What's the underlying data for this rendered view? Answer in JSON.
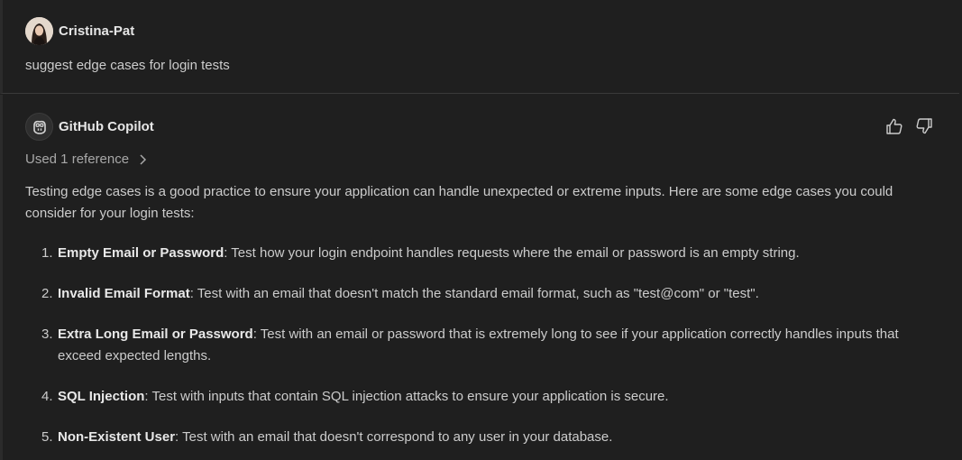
{
  "user": {
    "name": "Cristina-Pat",
    "message": "suggest edge cases for login tests"
  },
  "copilot": {
    "name": "GitHub Copilot",
    "reference": "Used 1 reference",
    "intro": "Testing edge cases is a good practice to ensure your application can handle unexpected or extreme inputs. Here are some edge cases you could consider for your login tests:",
    "items": [
      {
        "num": "1.",
        "title": "Empty Email or Password",
        "text": ": Test how your login endpoint handles requests where the email or password is an empty string."
      },
      {
        "num": "2.",
        "title": "Invalid Email Format",
        "text": ": Test with an email that doesn't match the standard email format, such as \"test@com\" or \"test\"."
      },
      {
        "num": "3.",
        "title": "Extra Long Email or Password",
        "text": ": Test with an email or password that is extremely long to see if your application correctly handles inputs that exceed expected lengths."
      },
      {
        "num": "4.",
        "title": "SQL Injection",
        "text": ": Test with inputs that contain SQL injection attacks to ensure your application is secure."
      },
      {
        "num": "5.",
        "title": "Non-Existent User",
        "text": ": Test with an email that doesn't correspond to any user in your database."
      }
    ]
  },
  "icons": {
    "avatar": "user-avatar-photo",
    "copilot": "copilot-icon",
    "thumbs_up": "thumbs-up-icon",
    "thumbs_down": "thumbs-down-icon",
    "chevron": "chevron-right-icon"
  },
  "colors": {
    "background": "#1f1f1f",
    "text": "#cccccc",
    "muted": "#a8a8a8",
    "divider": "#3a3a3a"
  }
}
